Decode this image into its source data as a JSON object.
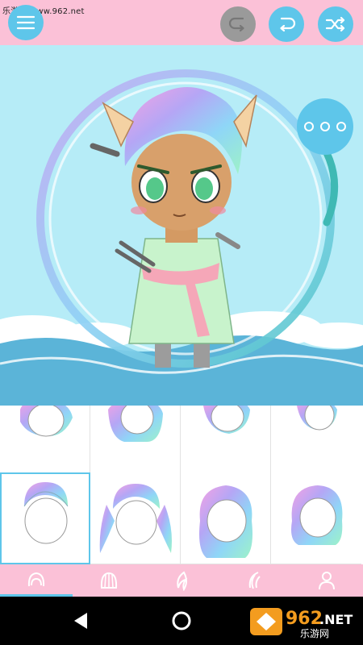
{
  "watermark": {
    "text": "乐游网 www.962.net"
  },
  "toolbar": {
    "menu_icon": "hamburger-menu-icon",
    "undo_icon": "undo-icon",
    "redo_icon": "redo-icon",
    "shuffle_icon": "shuffle-icon",
    "undo_enabled": false
  },
  "stage": {
    "more_icon": "more-options-icon",
    "character": "chibi character with pastel rainbow hair, cat ears and swords"
  },
  "hair_grid": {
    "selected_index": 4,
    "items": [
      "hair-style-1",
      "hair-style-2",
      "hair-style-3",
      "hair-style-4",
      "hair-style-5",
      "hair-style-6",
      "hair-style-7",
      "hair-style-8"
    ]
  },
  "tabs": [
    {
      "icon": "front-hair-icon",
      "active": true
    },
    {
      "icon": "back-hair-icon",
      "active": false
    },
    {
      "icon": "hair-strand-icon",
      "active": false
    },
    {
      "icon": "hair-accessory-icon",
      "active": false
    },
    {
      "icon": "body-icon",
      "active": false
    }
  ],
  "navbar": {
    "back_icon": "back-triangle-icon",
    "home_icon": "home-circle-icon"
  },
  "logo": {
    "number": "962",
    "suffix": ".NET",
    "chinese": "乐游网"
  },
  "colors": {
    "accent": "#5ec6ea",
    "toolbar_bg": "#fbc1d7",
    "stage_bg": "#b6ecf7",
    "disabled": "#9a9a9a"
  }
}
